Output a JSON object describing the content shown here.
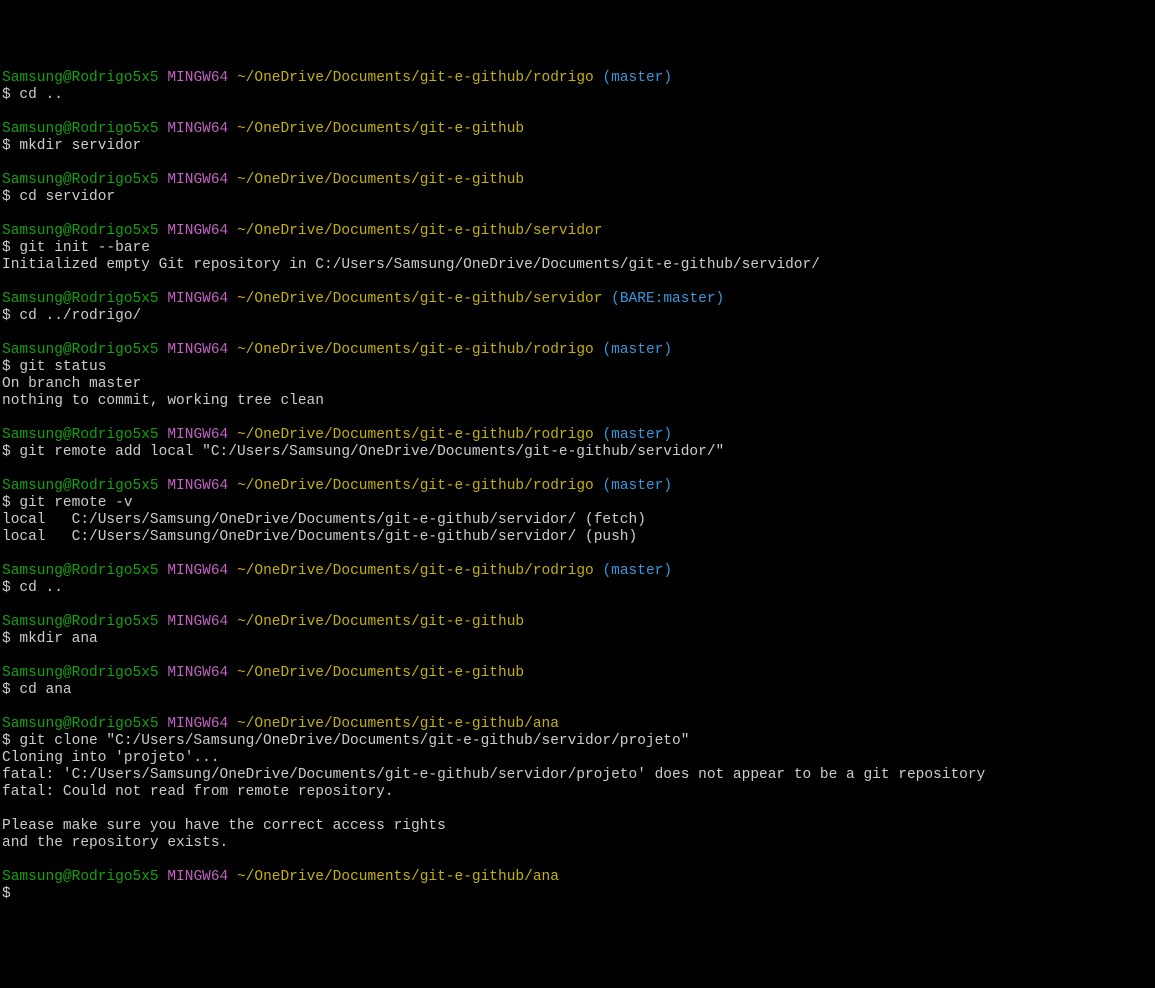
{
  "user": "Samsung@Rodrigo5x5",
  "host": "MINGW64",
  "paths": {
    "rodrigo": "~/OneDrive/Documents/git-e-github/rodrigo",
    "root": "~/OneDrive/Documents/git-e-github",
    "servidor": "~/OneDrive/Documents/git-e-github/servidor",
    "ana": "~/OneDrive/Documents/git-e-github/ana"
  },
  "branches": {
    "master": "(master)",
    "bare": "(BARE:master)"
  },
  "prompt": "$",
  "commands": {
    "cd_up": "cd ..",
    "mkdir_servidor": "mkdir servidor",
    "cd_servidor": "cd servidor",
    "git_init_bare": "git init --bare",
    "cd_rodrigo": "cd ../rodrigo/",
    "git_status": "git status",
    "git_remote_add": "git remote add local \"C:/Users/Samsung/OneDrive/Documents/git-e-github/servidor/\"",
    "git_remote_v": "git remote -v",
    "mkdir_ana": "mkdir ana",
    "cd_ana": "cd ana",
    "git_clone": "git clone \"C:/Users/Samsung/OneDrive/Documents/git-e-github/servidor/projeto\""
  },
  "outputs": {
    "init": "Initialized empty Git repository in C:/Users/Samsung/OneDrive/Documents/git-e-github/servidor/",
    "status1": "On branch master",
    "status2": "nothing to commit, working tree clean",
    "remote_fetch": "local   C:/Users/Samsung/OneDrive/Documents/git-e-github/servidor/ (fetch)",
    "remote_push": "local   C:/Users/Samsung/OneDrive/Documents/git-e-github/servidor/ (push)",
    "clone1": "Cloning into 'projeto'...",
    "clone2": "fatal: 'C:/Users/Samsung/OneDrive/Documents/git-e-github/servidor/projeto' does not appear to be a git repository",
    "clone3": "fatal: Could not read from remote repository.",
    "clone4": "Please make sure you have the correct access rights",
    "clone5": "and the repository exists."
  }
}
